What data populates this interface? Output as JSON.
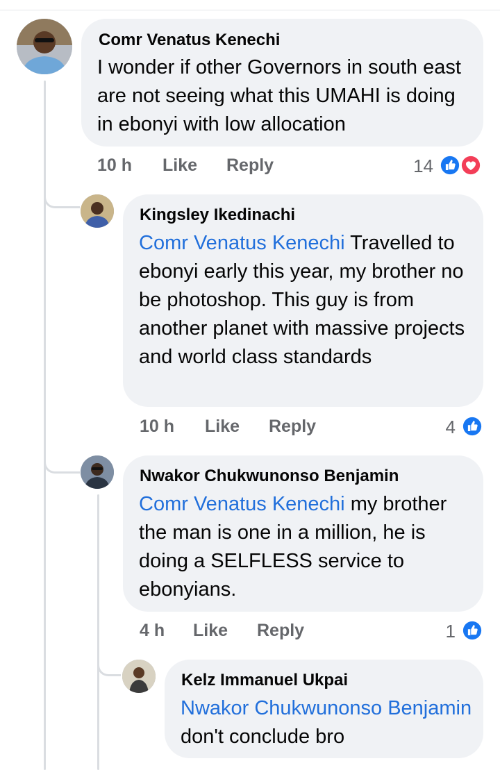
{
  "comments": [
    {
      "author": "Comr Venatus Kenechi",
      "mention": "",
      "text": "I wonder if other Governors in south east are not seeing what this UMAHI is doing in ebonyi with low allocation",
      "time": "10 h",
      "like": "Like",
      "reply": "Reply",
      "reaction_count": "14",
      "reactions": [
        "like-icon",
        "love-icon"
      ]
    },
    {
      "author": "Kingsley Ikedinachi",
      "mention": "Comr Venatus Kenechi",
      "text": "Travelled to ebonyi early this year, my brother no be photoshop. This guy is from another planet with massive projects and world class standards",
      "time": "10 h",
      "like": "Like",
      "reply": "Reply",
      "reaction_count": "4",
      "reactions": [
        "like-icon"
      ]
    },
    {
      "author": "Nwakor Chukwunonso Benjamin",
      "mention": "Comr Venatus Kenechi",
      "text": "my brother the man is one in a million, he is doing a SELFLESS service to ebonyians.",
      "time": "4 h",
      "like": "Like",
      "reply": "Reply",
      "reaction_count": "1",
      "reactions": [
        "like-icon"
      ]
    },
    {
      "author": "Kelz Immanuel Ukpai",
      "mention": "Nwakor Chukwunonso Benjamin",
      "text": "don't conclude bro"
    }
  ],
  "colors": {
    "bubble": "#f0f2f5",
    "mention": "#216fdb",
    "meta": "#65676b",
    "like_blue": "#1877f2",
    "love_red": "#f33e58"
  }
}
